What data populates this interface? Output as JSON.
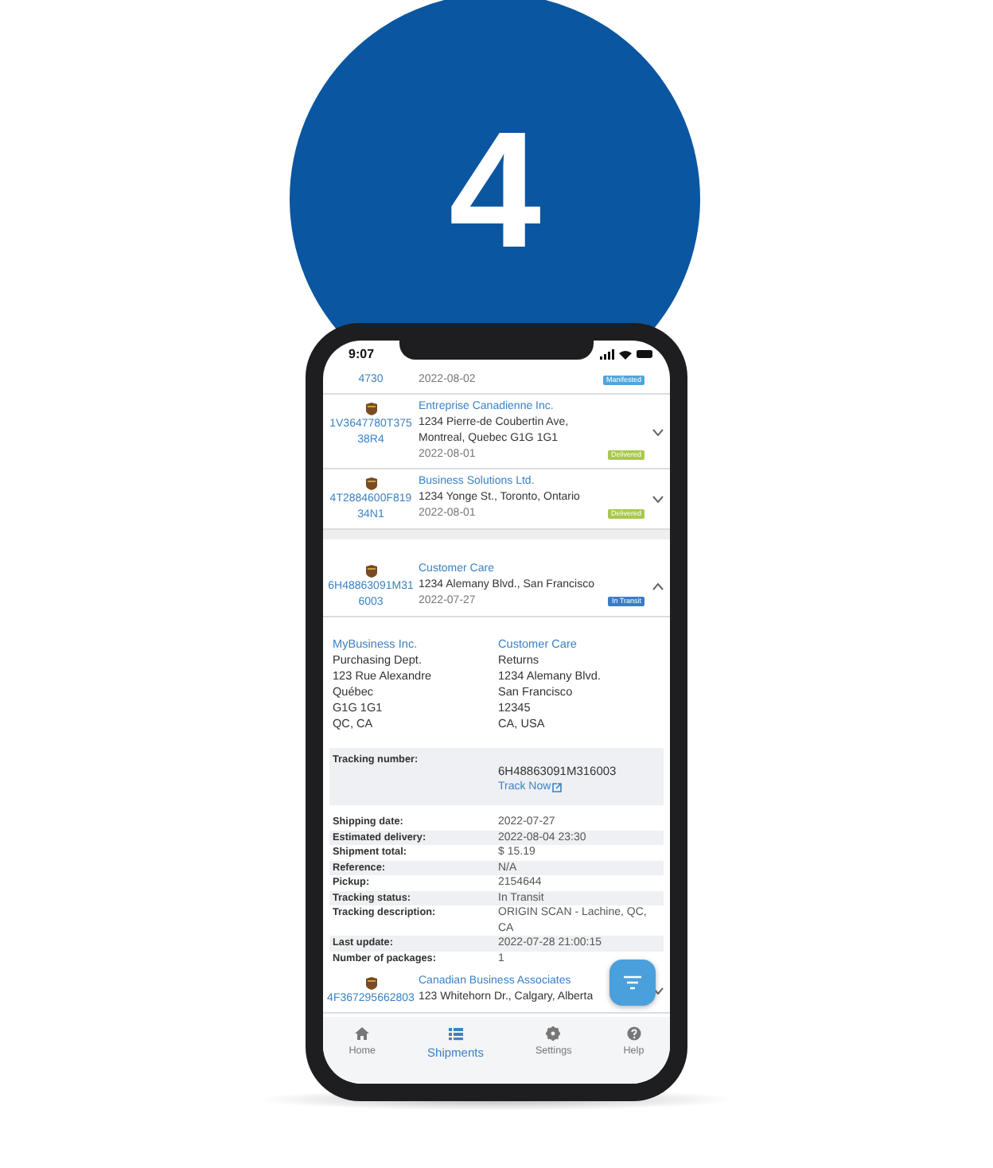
{
  "step_number": "4",
  "status_bar": {
    "time": "9:07"
  },
  "shipments": [
    {
      "tracking": [
        "4730"
      ],
      "date": "2022-08-02",
      "status": "Manifested",
      "color": "#4ea6dc"
    },
    {
      "tracking": [
        "1V3647780T375",
        "38R4"
      ],
      "company": "Entreprise Canadienne Inc.",
      "address": [
        "1234 Pierre-de Coubertin Ave,",
        "Montreal, Quebec G1G 1G1"
      ],
      "date": "2022-08-01",
      "status": "Delivered",
      "color": "#a9c94a",
      "expanded": false
    },
    {
      "tracking": [
        "4T2884600F819",
        "34N1"
      ],
      "company": "Business Solutions Ltd.",
      "address": [
        "1234 Yonge St., Toronto, Ontario"
      ],
      "date": "2022-08-01",
      "status": "Delivered",
      "color": "#a9c94a",
      "expanded": false
    },
    {
      "tracking": [
        "6H48863091M31",
        "6003"
      ],
      "company": "Customer Care",
      "address": [
        "1234 Alemany Blvd., San Francisco"
      ],
      "date": "2022-07-27",
      "status": "In Transit",
      "color": "#3a7cc6",
      "expanded": true
    },
    {
      "tracking": [
        "4F367295662803"
      ],
      "company": "Canadian Business Associates",
      "address": [
        "123 Whitehorn Dr., Calgary, Alberta"
      ],
      "expanded": false
    }
  ],
  "details": {
    "from": {
      "name": "MyBusiness Inc.",
      "lines": [
        "Purchasing Dept.",
        "123 Rue Alexandre",
        "Québec",
        "G1G 1G1",
        "QC, CA"
      ]
    },
    "to": {
      "name": "Customer Care",
      "lines": [
        "Returns",
        "1234 Alemany Blvd.",
        "San Francisco",
        "12345",
        "CA, USA"
      ]
    },
    "tracking_label": "Tracking number:",
    "tracking_value": "6H48863091M316003",
    "track_link": "Track Now",
    "fields": [
      {
        "label": "Shipping date:",
        "value": "2022-07-27"
      },
      {
        "label": "Estimated delivery:",
        "value": "2022-08-04 23:30"
      },
      {
        "label": "Shipment total:",
        "value": "$ 15.19"
      },
      {
        "label": "Reference:",
        "value": "N/A"
      },
      {
        "label": "Pickup:",
        "value": "2154644"
      },
      {
        "label": "Tracking status:",
        "value": "In Transit"
      },
      {
        "label": "Tracking description:",
        "value": "ORIGIN SCAN - Lachine, QC, CA"
      },
      {
        "label": "Last update:",
        "value": "2022-07-28 21:00:15"
      },
      {
        "label": "Number of packages:",
        "value": "1"
      }
    ]
  },
  "nav": [
    {
      "kind": "home",
      "label": "Home",
      "selected": false
    },
    {
      "kind": "list",
      "label": "Shipments",
      "selected": true
    },
    {
      "kind": "gear",
      "label": "Settings",
      "selected": false
    },
    {
      "kind": "help",
      "label": "Help",
      "selected": false
    }
  ]
}
